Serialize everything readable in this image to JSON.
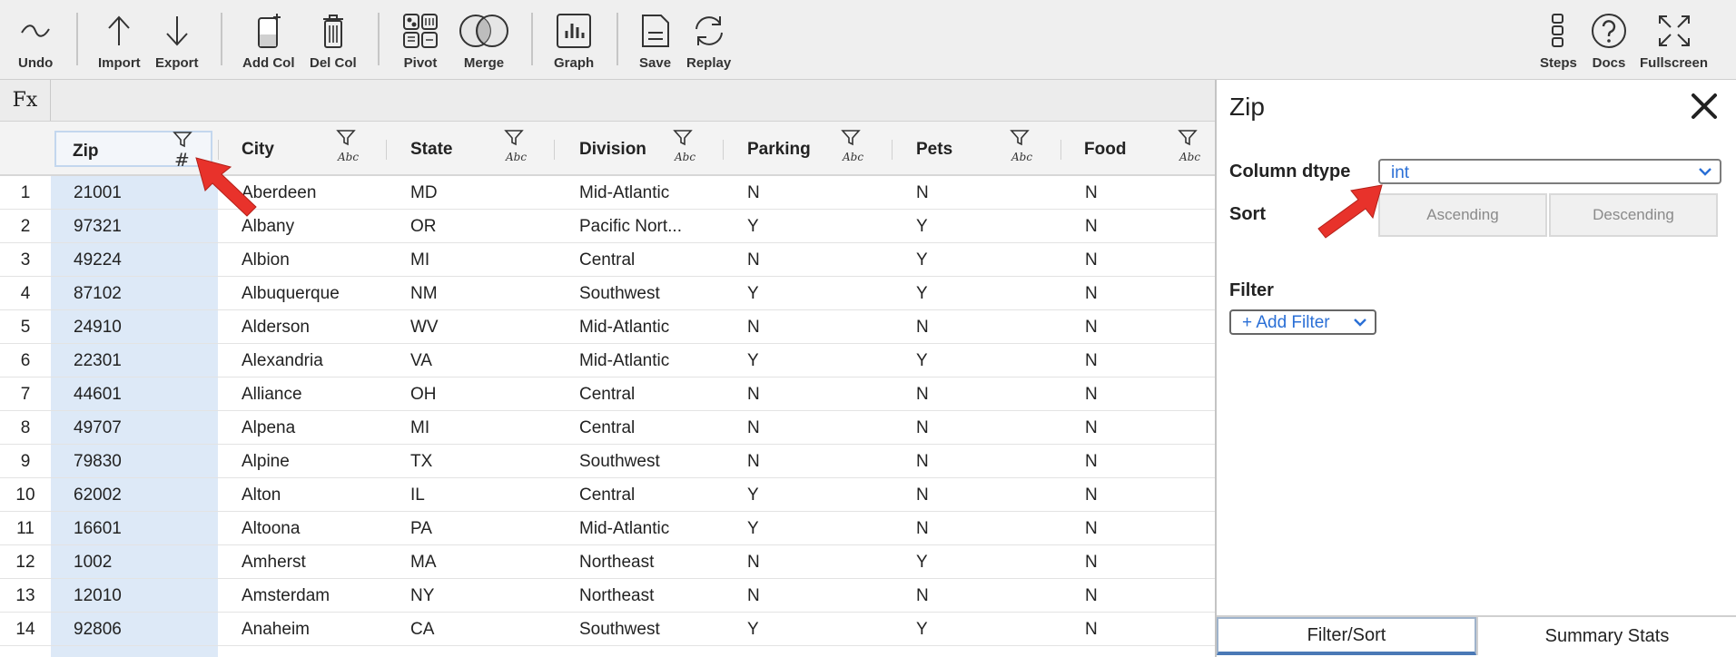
{
  "toolbar": {
    "undo": "Undo",
    "import": "Import",
    "export": "Export",
    "add_col": "Add Col",
    "del_col": "Del Col",
    "pivot": "Pivot",
    "merge": "Merge",
    "graph": "Graph",
    "save": "Save",
    "replay": "Replay",
    "steps": "Steps",
    "docs": "Docs",
    "fullscreen": "Fullscreen"
  },
  "formula_bar": {
    "label": "Fx",
    "value": ""
  },
  "columns": [
    {
      "name": "Zip",
      "dtype_icon": "#"
    },
    {
      "name": "City",
      "dtype_icon": "Abc"
    },
    {
      "name": "State",
      "dtype_icon": "Abc"
    },
    {
      "name": "Division",
      "dtype_icon": "Abc"
    },
    {
      "name": "Parking",
      "dtype_icon": "Abc"
    },
    {
      "name": "Pets",
      "dtype_icon": "Abc"
    },
    {
      "name": "Food",
      "dtype_icon": "Abc"
    }
  ],
  "rows": [
    {
      "idx": "1",
      "zip": "21001",
      "city": "Aberdeen",
      "state": "MD",
      "division": "Mid-Atlantic",
      "parking": "N",
      "pets": "N",
      "food": "N"
    },
    {
      "idx": "2",
      "zip": "97321",
      "city": "Albany",
      "state": "OR",
      "division": "Pacific Nort...",
      "parking": "Y",
      "pets": "Y",
      "food": "N"
    },
    {
      "idx": "3",
      "zip": "49224",
      "city": "Albion",
      "state": "MI",
      "division": "Central",
      "parking": "N",
      "pets": "Y",
      "food": "N"
    },
    {
      "idx": "4",
      "zip": "87102",
      "city": "Albuquerque",
      "state": "NM",
      "division": "Southwest",
      "parking": "Y",
      "pets": "Y",
      "food": "N"
    },
    {
      "idx": "5",
      "zip": "24910",
      "city": "Alderson",
      "state": "WV",
      "division": "Mid-Atlantic",
      "parking": "N",
      "pets": "N",
      "food": "N"
    },
    {
      "idx": "6",
      "zip": "22301",
      "city": "Alexandria",
      "state": "VA",
      "division": "Mid-Atlantic",
      "parking": "Y",
      "pets": "Y",
      "food": "N"
    },
    {
      "idx": "7",
      "zip": "44601",
      "city": "Alliance",
      "state": "OH",
      "division": "Central",
      "parking": "N",
      "pets": "N",
      "food": "N"
    },
    {
      "idx": "8",
      "zip": "49707",
      "city": "Alpena",
      "state": "MI",
      "division": "Central",
      "parking": "N",
      "pets": "N",
      "food": "N"
    },
    {
      "idx": "9",
      "zip": "79830",
      "city": "Alpine",
      "state": "TX",
      "division": "Southwest",
      "parking": "N",
      "pets": "N",
      "food": "N"
    },
    {
      "idx": "10",
      "zip": "62002",
      "city": "Alton",
      "state": "IL",
      "division": "Central",
      "parking": "Y",
      "pets": "N",
      "food": "N"
    },
    {
      "idx": "11",
      "zip": "16601",
      "city": "Altoona",
      "state": "PA",
      "division": "Mid-Atlantic",
      "parking": "Y",
      "pets": "N",
      "food": "N"
    },
    {
      "idx": "12",
      "zip": "1002",
      "city": "Amherst",
      "state": "MA",
      "division": "Northeast",
      "parking": "N",
      "pets": "Y",
      "food": "N"
    },
    {
      "idx": "13",
      "zip": "12010",
      "city": "Amsterdam",
      "state": "NY",
      "division": "Northeast",
      "parking": "N",
      "pets": "N",
      "food": "N"
    },
    {
      "idx": "14",
      "zip": "92806",
      "city": "Anaheim",
      "state": "CA",
      "division": "Southwest",
      "parking": "Y",
      "pets": "Y",
      "food": "N"
    }
  ],
  "panel": {
    "title": "Zip",
    "dtype_label": "Column dtype",
    "dtype_value": "int",
    "sort_label": "Sort",
    "ascending": "Ascending",
    "descending": "Descending",
    "filter_label": "Filter",
    "add_filter": "+ Add Filter",
    "tab_filter_sort": "Filter/Sort",
    "tab_summary_stats": "Summary Stats"
  },
  "colors": {
    "selected_column": "#dde9f7",
    "accent_blue": "#2a6fd6",
    "annotation_arrow": "#e8322b"
  }
}
